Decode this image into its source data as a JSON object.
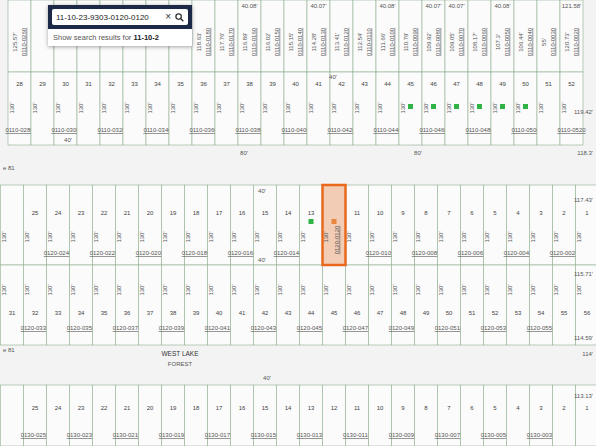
{
  "search": {
    "value": "11-10-23-9303-0120-0120",
    "clear": "×",
    "suggestion_prefix": "Show search results for ",
    "suggestion_term": "11-10-2"
  },
  "blocks": [
    {
      "name": "north-upper",
      "lots": [
        {
          "depth": "125.57'",
          "id": "0110-0260",
          "selected": false
        },
        {
          "selected": false
        },
        {
          "selected": false
        },
        {
          "selected": false
        },
        {
          "selected": false
        },
        {
          "selected": false
        },
        {
          "selected": false
        },
        {
          "selected": false
        },
        {
          "depth": "118.63'",
          "id": "0110-0180",
          "selected": false
        },
        {
          "depth": "117.76'",
          "id": "0110-0170",
          "selected": false
        },
        {
          "depth": "116.89'",
          "id": "0110-0160",
          "frontage": "40.08'",
          "selected": false
        },
        {
          "depth": "116.02'",
          "id": "0110-0150",
          "selected": false
        },
        {
          "depth": "115.15'",
          "id": "0110-0140",
          "selected": false
        },
        {
          "depth": "114.28'",
          "id": "0110-0130",
          "frontage": "40.07'",
          "selected": false
        },
        {
          "depth": "113.41'",
          "id": "0110-0120",
          "selected": false
        },
        {
          "depth": "112.54'",
          "id": "0110-0110",
          "selected": false
        },
        {
          "depth": "111.66'",
          "id": "0110-0100",
          "frontage": "40.08'",
          "selected": false
        },
        {
          "depth": "110.79'",
          "id": "0110-0090",
          "selected": false
        },
        {
          "depth": "109.92'",
          "id": "0110-0080",
          "frontage": "40.07'",
          "selected": false
        },
        {
          "depth": "109.05'",
          "id": "0110-0070",
          "frontage": "40.07'",
          "selected": false
        },
        {
          "depth": "108.17'",
          "id": "0110-0060",
          "selected": false
        },
        {
          "depth": "107.3'",
          "id": "0110-0050",
          "frontage": "40.08'",
          "selected": false
        },
        {
          "depth": "106.44'",
          "id": "0110-0040",
          "selected": false
        },
        {
          "depth": "55'",
          "id": "0110-0030",
          "selected": false
        },
        {
          "depth": "120.73'",
          "id": "0110-0020",
          "frontage": "121.58'",
          "selected": false
        }
      ]
    },
    {
      "name": "north-lower",
      "lots": [
        {
          "num": "28",
          "depth": "130'",
          "id": "0110-0280",
          "selected": false
        },
        {
          "num": "29",
          "depth": "130'",
          "selected": false
        },
        {
          "num": "30",
          "depth": "130'",
          "id": "0110-0300",
          "selected": false
        },
        {
          "num": "31",
          "depth": "130'",
          "selected": false
        },
        {
          "num": "32",
          "depth": "130'",
          "id": "0110-0320",
          "selected": false
        },
        {
          "num": "33",
          "depth": "130'",
          "selected": false
        },
        {
          "num": "34",
          "depth": "130'",
          "id": "0110-0340",
          "selected": false
        },
        {
          "num": "35",
          "depth": "130'",
          "selected": false
        },
        {
          "num": "36",
          "depth": "130'",
          "id": "0110-0360",
          "selected": false
        },
        {
          "num": "37",
          "depth": "130'",
          "selected": false
        },
        {
          "num": "38",
          "depth": "130'",
          "id": "0110-0380",
          "selected": false
        },
        {
          "num": "39",
          "depth": "130'",
          "selected": false
        },
        {
          "num": "40",
          "depth": "130'",
          "id": "0110-0400",
          "selected": false
        },
        {
          "num": "41",
          "depth": "130'",
          "selected": false
        },
        {
          "num": "42",
          "depth": "130'",
          "id": "0110-0420",
          "selected": false
        },
        {
          "num": "43",
          "depth": "130'",
          "selected": false
        },
        {
          "num": "44",
          "depth": "130'",
          "id": "0110-0440",
          "selected": false
        },
        {
          "num": "45",
          "depth": "130'",
          "marker_color": "#2fb344",
          "selected": false
        },
        {
          "num": "46",
          "depth": "130'",
          "id": "0110-0460",
          "marker_color": "#2fb344",
          "selected": false
        },
        {
          "num": "47",
          "depth": "130'",
          "marker_color": "#2fb344",
          "selected": false
        },
        {
          "num": "48",
          "depth": "130'",
          "id": "0110-0480",
          "marker_color": "#2fb344",
          "selected": false
        },
        {
          "num": "49",
          "depth": "130'",
          "marker_color": "#2fb344",
          "selected": false
        },
        {
          "num": "50",
          "depth": "130'",
          "id": "0110-0500",
          "marker_color": "#2fb344",
          "selected": false
        },
        {
          "num": "51",
          "depth": "130'",
          "selected": false
        },
        {
          "num": "52",
          "depth": "130'",
          "id": "0110-0520",
          "selected": false
        }
      ]
    },
    {
      "name": "middle-upper",
      "lots": [
        {
          "depth": "130'",
          "selected": false
        },
        {
          "num": "25",
          "depth": "130'",
          "selected": false
        },
        {
          "num": "24",
          "depth": "130'",
          "id": "0120-0240",
          "selected": false
        },
        {
          "num": "23",
          "depth": "130'",
          "selected": false
        },
        {
          "num": "22",
          "depth": "130'",
          "id": "0120-0220",
          "selected": false
        },
        {
          "num": "21",
          "depth": "130'",
          "selected": false
        },
        {
          "num": "20",
          "depth": "130'",
          "id": "0120-0200",
          "selected": false
        },
        {
          "num": "19",
          "depth": "130'",
          "selected": false
        },
        {
          "num": "18",
          "depth": "130'",
          "id": "0120-0180",
          "selected": false
        },
        {
          "num": "17",
          "depth": "130'",
          "selected": false
        },
        {
          "num": "16",
          "depth": "130'",
          "id": "0120-0160",
          "selected": false
        },
        {
          "num": "15",
          "depth": "130'",
          "selected": false
        },
        {
          "num": "14",
          "depth": "130'",
          "id": "0120-0140",
          "selected": false
        },
        {
          "num": "13",
          "depth": "130'",
          "marker_color": "#2fb344",
          "selected": false
        },
        {
          "depth": "130'",
          "id": "0120-0120",
          "marker_color": "#e8863f",
          "selected": true
        },
        {
          "num": "11",
          "depth": "130'",
          "selected": false
        },
        {
          "num": "10",
          "depth": "130'",
          "id": "0120-0100",
          "selected": false
        },
        {
          "num": "9",
          "depth": "130'",
          "selected": false
        },
        {
          "num": "8",
          "depth": "130'",
          "id": "0120-0080",
          "selected": false
        },
        {
          "num": "7",
          "depth": "130'",
          "selected": false
        },
        {
          "num": "6",
          "depth": "130'",
          "id": "0120-0060",
          "selected": false
        },
        {
          "num": "5",
          "depth": "130'",
          "selected": false
        },
        {
          "num": "4",
          "depth": "130'",
          "id": "0120-0040",
          "selected": false
        },
        {
          "num": "3",
          "depth": "130'",
          "selected": false
        },
        {
          "num": "2",
          "depth": "130'",
          "id": "0120-0020",
          "selected": false
        },
        {
          "num": "1",
          "depth": "130'",
          "selected": false
        }
      ]
    },
    {
      "name": "middle-lower",
      "lots": [
        {
          "num": "31",
          "depth": "130'",
          "selected": false
        },
        {
          "num": "32",
          "depth": "130'",
          "id": "0120-0330",
          "selected": false
        },
        {
          "num": "33",
          "depth": "130'",
          "selected": false
        },
        {
          "num": "34",
          "depth": "130'",
          "id": "0120-0350",
          "selected": false
        },
        {
          "num": "35",
          "depth": "130'",
          "selected": false
        },
        {
          "num": "36",
          "depth": "130'",
          "id": "0120-0370",
          "selected": false
        },
        {
          "num": "37",
          "depth": "130'",
          "selected": false
        },
        {
          "num": "38",
          "depth": "130'",
          "id": "0120-0390",
          "selected": false
        },
        {
          "num": "39",
          "depth": "130'",
          "selected": false
        },
        {
          "num": "40",
          "depth": "130'",
          "id": "0120-0410",
          "selected": false
        },
        {
          "num": "41",
          "depth": "130'",
          "selected": false
        },
        {
          "num": "42",
          "depth": "130'",
          "id": "0120-0430",
          "selected": false
        },
        {
          "num": "43",
          "depth": "130'",
          "selected": false
        },
        {
          "num": "44",
          "depth": "130'",
          "id": "0120-0450",
          "selected": false
        },
        {
          "num": "45",
          "depth": "130'",
          "selected": false
        },
        {
          "num": "46",
          "depth": "130'",
          "id": "0120-0470",
          "selected": false
        },
        {
          "num": "47",
          "depth": "130'",
          "selected": false
        },
        {
          "num": "48",
          "depth": "130'",
          "id": "0120-0490",
          "selected": false
        },
        {
          "num": "49",
          "depth": "130'",
          "selected": false
        },
        {
          "num": "50",
          "depth": "130'",
          "id": "0120-0510",
          "selected": false
        },
        {
          "num": "51",
          "depth": "130'",
          "selected": false
        },
        {
          "num": "52",
          "depth": "130'",
          "id": "0120-0530",
          "selected": false
        },
        {
          "num": "53",
          "depth": "130'",
          "selected": false
        },
        {
          "num": "54",
          "depth": "130'",
          "id": "0120-0550",
          "selected": false
        },
        {
          "num": "55",
          "depth": "130'",
          "selected": false
        },
        {
          "num": "56",
          "depth": "130'",
          "selected": false
        }
      ]
    },
    {
      "name": "south",
      "lots": [
        {
          "selected": false
        },
        {
          "num": "25",
          "id": "0130-0250",
          "selected": false
        },
        {
          "num": "24",
          "selected": false
        },
        {
          "num": "23",
          "id": "0130-0230",
          "selected": false
        },
        {
          "num": "22",
          "selected": false
        },
        {
          "num": "21",
          "id": "0130-0210",
          "selected": false
        },
        {
          "num": "20",
          "selected": false
        },
        {
          "num": "19",
          "id": "0130-0190",
          "selected": false
        },
        {
          "num": "18",
          "selected": false
        },
        {
          "num": "17",
          "id": "0130-0170",
          "selected": false
        },
        {
          "num": "16",
          "selected": false
        },
        {
          "num": "15",
          "id": "0130-0150",
          "selected": false
        },
        {
          "num": "14",
          "selected": false
        },
        {
          "num": "13",
          "id": "0130-0130",
          "selected": false
        },
        {
          "num": "12",
          "selected": false
        },
        {
          "num": "11",
          "id": "0130-0110",
          "selected": false
        },
        {
          "num": "10",
          "selected": false
        },
        {
          "num": "9",
          "id": "0130-0090",
          "selected": false
        },
        {
          "num": "8",
          "selected": false
        },
        {
          "num": "7",
          "id": "0130-0070",
          "selected": false
        },
        {
          "num": "6",
          "selected": false
        },
        {
          "num": "5",
          "id": "0130-0050",
          "selected": false
        },
        {
          "num": "4",
          "selected": false
        },
        {
          "num": "3",
          "id": "0130-0030",
          "selected": false
        },
        {
          "num": "2",
          "selected": false
        },
        {
          "num": "1",
          "selected": false
        }
      ]
    }
  ],
  "labels": [
    "40'",
    "80'",
    "80'",
    "40'",
    "118.3'",
    "119.42'",
    "e 81",
    "40'",
    "117.43'",
    "40'",
    "115.71'",
    "114.59'",
    "e 81",
    "WEST LAKE",
    "FOREST",
    "114'",
    "40'",
    "113.13'"
  ]
}
